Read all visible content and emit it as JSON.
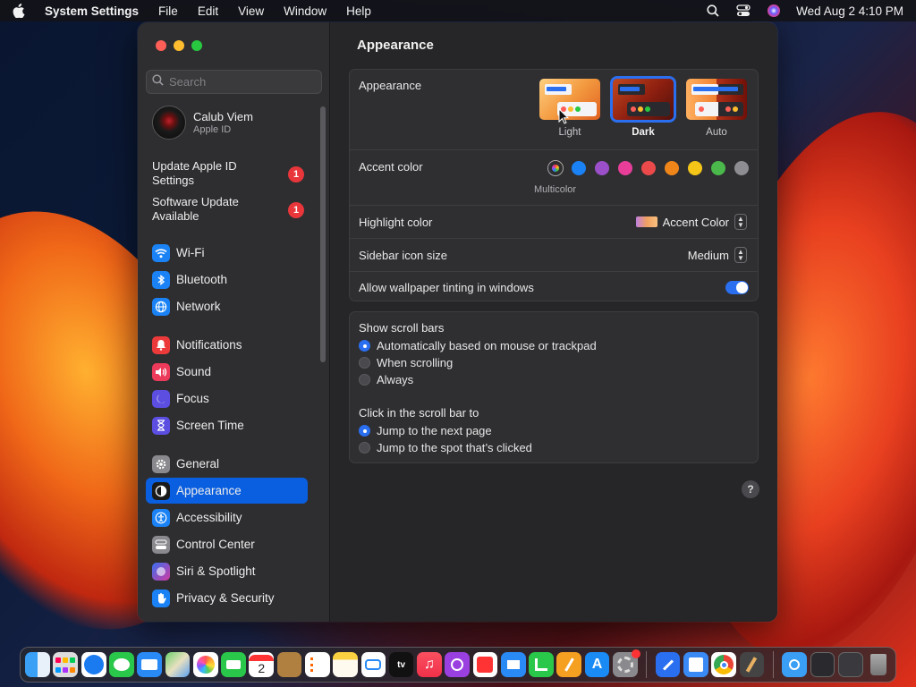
{
  "menubar": {
    "app_name": "System Settings",
    "items": [
      "File",
      "Edit",
      "View",
      "Window",
      "Help"
    ],
    "clock": "Wed Aug 2  4:10 PM"
  },
  "sidebar": {
    "search_placeholder": "Search",
    "profile": {
      "name": "Calub Viem",
      "subtitle": "Apple ID"
    },
    "notices": [
      {
        "label": "Update Apple ID Settings",
        "badge": "1"
      },
      {
        "label": "Software Update Available",
        "badge": "1"
      }
    ],
    "items": [
      {
        "label": "Wi-Fi",
        "icon": "wifi-icon",
        "color": "#1a82f5"
      },
      {
        "label": "Bluetooth",
        "icon": "bluetooth-icon",
        "color": "#1a82f5"
      },
      {
        "label": "Network",
        "icon": "globe-icon",
        "color": "#1a82f5"
      },
      {
        "label": "Notifications",
        "icon": "bell-icon",
        "color": "#ec3a3a"
      },
      {
        "label": "Sound",
        "icon": "speaker-icon",
        "color": "#ec3a5a"
      },
      {
        "label": "Focus",
        "icon": "moon-icon",
        "color": "#5b4ee0"
      },
      {
        "label": "Screen Time",
        "icon": "hourglass-icon",
        "color": "#5b4ee0"
      },
      {
        "label": "General",
        "icon": "gear-icon",
        "color": "#8a8a8e"
      },
      {
        "label": "Appearance",
        "icon": "appearance-icon",
        "color": "#1a1a1a"
      },
      {
        "label": "Accessibility",
        "icon": "accessibility-icon",
        "color": "#1a82f5"
      },
      {
        "label": "Control Center",
        "icon": "control-center-icon",
        "color": "#8a8a8e"
      },
      {
        "label": "Siri & Spotlight",
        "icon": "siri-icon",
        "color": "#b03ad0"
      },
      {
        "label": "Privacy & Security",
        "icon": "hand-icon",
        "color": "#1a82f5"
      }
    ],
    "active_item": "Appearance"
  },
  "main": {
    "title": "Appearance",
    "appearance": {
      "label": "Appearance",
      "options": [
        "Light",
        "Dark",
        "Auto"
      ],
      "selected": "Dark"
    },
    "accent": {
      "label": "Accent color",
      "selected_name": "Multicolor",
      "colors": [
        "#1a82f5",
        "#9b4fc8",
        "#e83e9a",
        "#ec4a4a",
        "#f0861a",
        "#f5c518",
        "#4ab84a",
        "#8e8e92"
      ]
    },
    "highlight": {
      "label": "Highlight color",
      "value": "Accent Color"
    },
    "sidebar_icon_size": {
      "label": "Sidebar icon size",
      "value": "Medium"
    },
    "wallpaper_tinting": {
      "label": "Allow wallpaper tinting in windows",
      "enabled": true
    },
    "scroll_bars": {
      "label": "Show scroll bars",
      "options": [
        "Automatically based on mouse or trackpad",
        "When scrolling",
        "Always"
      ],
      "selected": 0
    },
    "click_scroll": {
      "label": "Click in the scroll bar to",
      "options": [
        "Jump to the next page",
        "Jump to the spot that’s clicked"
      ],
      "selected": 0
    },
    "help": "?"
  },
  "dock": {
    "apps": [
      "finder-icon",
      "launchpad-icon",
      "safari-icon",
      "messages-icon",
      "mail-icon",
      "maps-icon",
      "photos-icon",
      "facetime-icon",
      "calendar-icon",
      "notes-brown-icon",
      "reminders-icon",
      "notes-icon",
      "freeform-icon",
      "apple-tv-icon",
      "music-icon",
      "podcasts-icon",
      "news-icon",
      "keynote-icon",
      "numbers-icon",
      "pages-icon",
      "app-store-icon",
      "system-settings-icon",
      "xcode-icon",
      "preview-icon",
      "chrome-icon",
      "instruments-icon"
    ],
    "calendar_day": "2",
    "appletv_label": "tv",
    "tail": [
      "downloads-folder-icon",
      "window-snapshot-icon",
      "screenshot-icon",
      "trash-icon"
    ]
  }
}
